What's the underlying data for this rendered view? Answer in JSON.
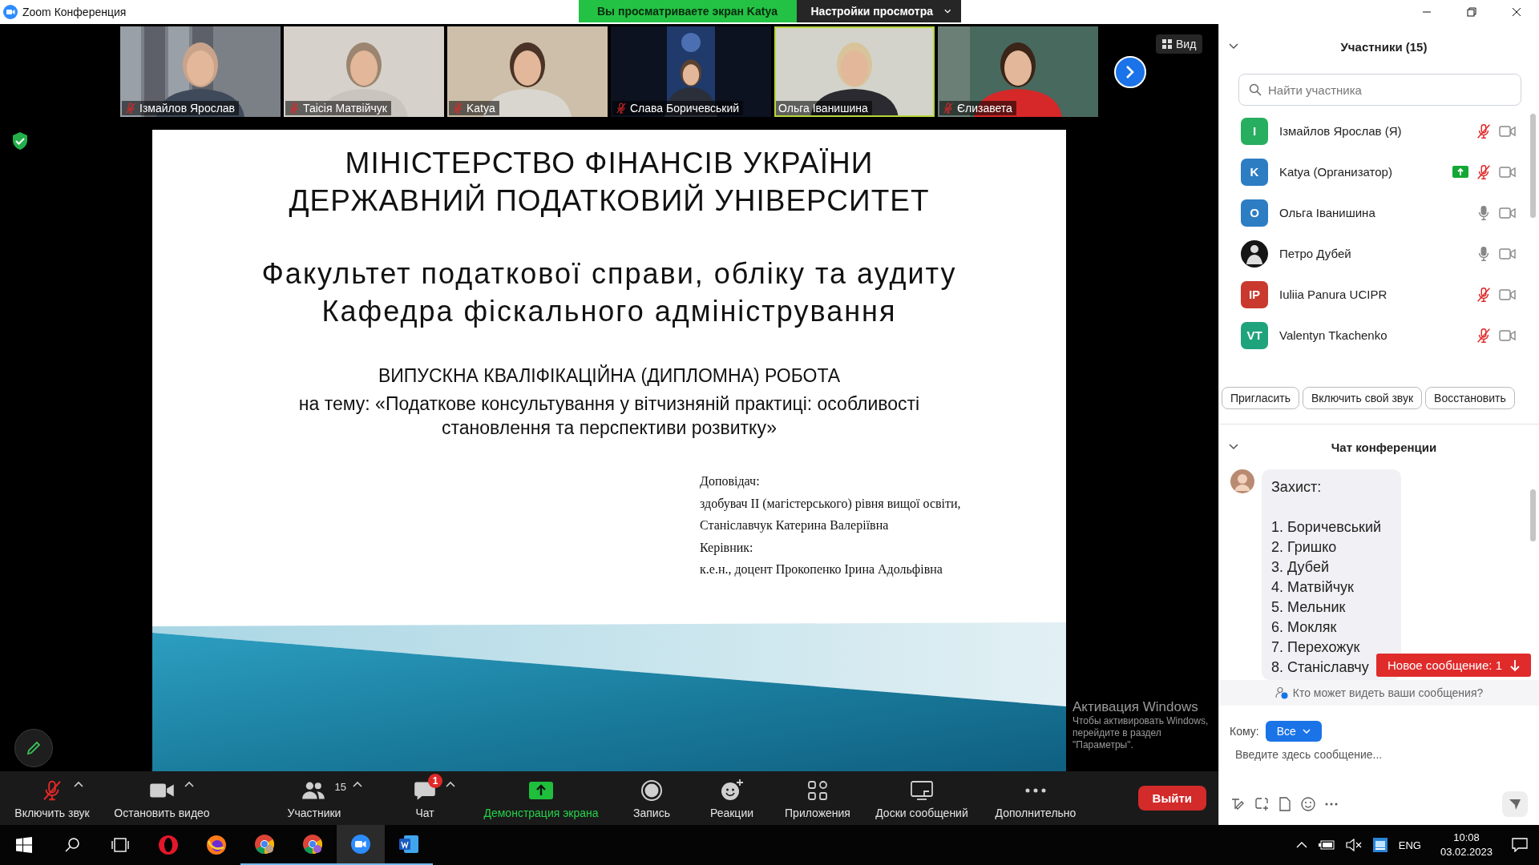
{
  "window": {
    "title": "Zoom Конференция"
  },
  "share_banner": {
    "status": "Вы просматриваете экран Katya",
    "view_options": "Настройки просмотра"
  },
  "video_strip": {
    "view_button": "Вид",
    "tiles": [
      {
        "name": "Ізмайлов Ярослав",
        "muted": true,
        "speaking": false
      },
      {
        "name": "Таісія Матвійчук",
        "muted": true,
        "speaking": false
      },
      {
        "name": "Katya",
        "muted": true,
        "speaking": false
      },
      {
        "name": "Слава Боричевський",
        "muted": true,
        "speaking": false
      },
      {
        "name": "Ольга Іванишина",
        "muted": false,
        "speaking": true
      },
      {
        "name": "Єлизавета",
        "muted": true,
        "speaking": false
      }
    ]
  },
  "slide": {
    "heading": [
      "МІНІСТЕРСТВО ФІНАНСІВ УКРАЇНИ",
      "ДЕРЖАВНИЙ ПОДАТКОВИЙ УНІВЕРСИТЕТ"
    ],
    "department": [
      "Факультет податкової справи, обліку та аудиту",
      "Кафедра фіскального адміністрування"
    ],
    "work_type": "ВИПУСКНА КВАЛІФІКАЦІЙНА (ДИПЛОМНА) РОБОТА",
    "topic": "на тему: «Податкове консультування у вітчизняній практиці: особливості становлення та перспективи розвитку»",
    "credits": [
      "Доповідач:",
      "здобувач II (магістерського) рівня вищої освіти,",
      "Станіславчук Катерина Валеріївна",
      "Керівник:",
      "к.е.н., доцент Прокопенко Ірина Адольфівна"
    ]
  },
  "toolbar": {
    "items": [
      {
        "kind": "mic",
        "label": "Включить звук",
        "muted": true,
        "caret": true
      },
      {
        "kind": "video",
        "label": "Остановить видео",
        "caret": true
      },
      {
        "kind": "participants",
        "label": "Участники",
        "count": "15",
        "caret": true
      },
      {
        "kind": "chat",
        "label": "Чат",
        "badge": "1",
        "caret": true
      },
      {
        "kind": "share",
        "label": "Демонстрация экрана",
        "caret": false
      },
      {
        "kind": "record",
        "label": "Запись",
        "caret": false
      },
      {
        "kind": "reactions",
        "label": "Реакции",
        "caret": false
      },
      {
        "kind": "apps",
        "label": "Приложения",
        "caret": false
      },
      {
        "kind": "whiteboards",
        "label": "Доски сообщений",
        "caret": false
      },
      {
        "kind": "more",
        "label": "Дополнительно",
        "caret": false
      }
    ],
    "leave": "Выйти"
  },
  "participants": {
    "title": "Участники (15)",
    "search": {
      "placeholder": "Найти участника"
    },
    "items": [
      {
        "name": "Ізмайлов Ярослав (Я)",
        "kind": "initials",
        "initials": "I",
        "color": "#27ae5f",
        "muted": true,
        "sharing": false
      },
      {
        "name": "Katya (Организатор)",
        "kind": "initials",
        "initials": "K",
        "color": "#2d7dc3",
        "muted": true,
        "sharing": true
      },
      {
        "name": "Ольга Іванишина",
        "kind": "initials",
        "initials": "O",
        "color": "#2d7dc3",
        "muted": false,
        "sharing": false
      },
      {
        "name": "Петро Дубей",
        "kind": "picture",
        "muted": false,
        "sharing": false
      },
      {
        "name": "Iuliia Panura UCIPR",
        "kind": "initials",
        "initials": "IP",
        "color": "#c9392e",
        "muted": true,
        "sharing": false
      },
      {
        "name": "Valentyn Tkachenko",
        "kind": "initials",
        "initials": "VT",
        "color": "#1fa37c",
        "muted": true,
        "sharing": false
      }
    ],
    "buttons": [
      "Пригласить",
      "Включить свой звук",
      "Восстановить"
    ]
  },
  "chat": {
    "title": "Чат конференции",
    "message": {
      "title": "Захист:",
      "items": [
        "1. Боричевський",
        "2. Гришко",
        "3. Дубей",
        "4. Матвійчук",
        "5. Мельник",
        "6. Мокляк",
        "7. Перехожук",
        "8. Станіславчу"
      ]
    },
    "new_message": "Новое сообщение: 1",
    "privacy": "Кто может видеть ваши сообщения?",
    "recipient_label": "Кому:",
    "recipient": "Все",
    "input": {
      "placeholder": "Введите здесь сообщение..."
    }
  },
  "activation_notice": {
    "title": "Активация Windows",
    "message": "Чтобы активировать Windows, перейдите в раздел \"Параметры\"."
  },
  "taskbar": {
    "apps": [
      {
        "kind": "opera",
        "running": false,
        "active": false
      },
      {
        "kind": "firefox",
        "running": false,
        "active": false
      },
      {
        "kind": "chrome",
        "running": true,
        "active": false
      },
      {
        "kind": "chrome-profile",
        "running": true,
        "active": false
      },
      {
        "kind": "zoom",
        "running": true,
        "active": true
      },
      {
        "kind": "word",
        "running": true,
        "active": false
      }
    ],
    "language": "ENG",
    "time": "10:08",
    "date": "03.02.2023"
  }
}
